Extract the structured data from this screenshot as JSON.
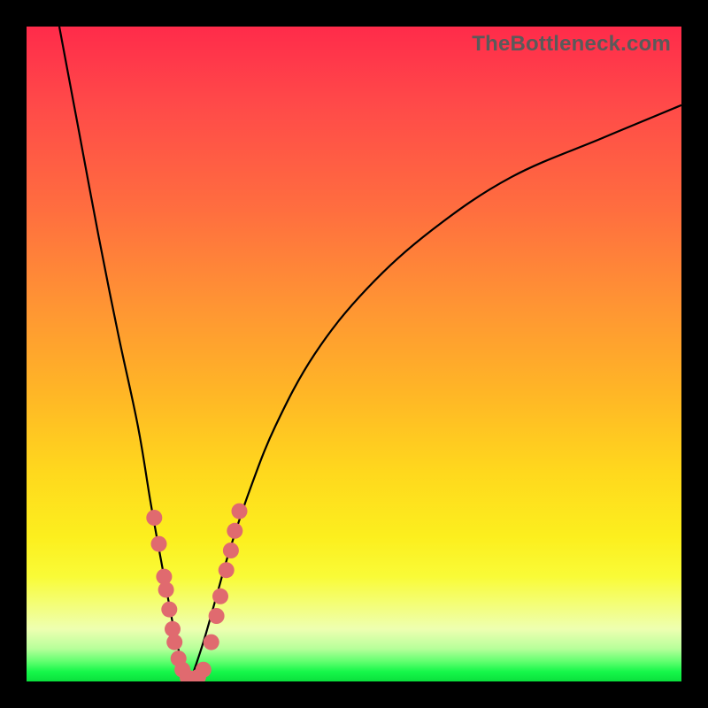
{
  "watermark": "TheBottleneck.com",
  "colors": {
    "frame": "#000000",
    "gradient_top": "#ff2b4a",
    "gradient_mid": "#ffd81d",
    "gradient_bottom": "#0ae03c",
    "curve": "#000000",
    "dots": "#e06a6f"
  },
  "chart_data": {
    "type": "line",
    "title": "",
    "xlabel": "",
    "ylabel": "",
    "xlim": [
      0,
      100
    ],
    "ylim": [
      0,
      100
    ],
    "note": "Two-branch V-shaped bottleneck curve. Values are bottleneck % (y, 0=bottom/no bottleneck, 100=top/severe) vs an implicit component-ratio axis (x). Points estimated from pixel positions.",
    "series": [
      {
        "name": "left-branch",
        "x": [
          5,
          8,
          11,
          14,
          17,
          19,
          21,
          22.5,
          23.7,
          25
        ],
        "y": [
          100,
          84,
          68,
          53,
          39,
          27,
          16,
          8,
          3,
          0
        ]
      },
      {
        "name": "right-branch",
        "x": [
          25,
          27,
          29,
          31,
          34,
          38,
          44,
          52,
          62,
          74,
          88,
          100
        ],
        "y": [
          0,
          6,
          13,
          20,
          29,
          39,
          50,
          60,
          69,
          77,
          83,
          88
        ]
      }
    ],
    "highlight_points": {
      "name": "cluster-near-minimum",
      "note": "Salmon dots clustered along both branches near the bottom of the V",
      "points": [
        {
          "x": 19.5,
          "y": 25
        },
        {
          "x": 20.2,
          "y": 21
        },
        {
          "x": 21.0,
          "y": 16
        },
        {
          "x": 21.3,
          "y": 14
        },
        {
          "x": 21.8,
          "y": 11
        },
        {
          "x": 22.3,
          "y": 8
        },
        {
          "x": 22.6,
          "y": 6
        },
        {
          "x": 23.2,
          "y": 3.5
        },
        {
          "x": 23.8,
          "y": 1.8
        },
        {
          "x": 24.6,
          "y": 0.6
        },
        {
          "x": 25.4,
          "y": 0.4
        },
        {
          "x": 26.2,
          "y": 0.7
        },
        {
          "x": 27.0,
          "y": 1.8
        },
        {
          "x": 28.2,
          "y": 6
        },
        {
          "x": 29.0,
          "y": 10
        },
        {
          "x": 29.6,
          "y": 13
        },
        {
          "x": 30.5,
          "y": 17
        },
        {
          "x": 31.2,
          "y": 20
        },
        {
          "x": 31.8,
          "y": 23
        },
        {
          "x": 32.5,
          "y": 26
        }
      ]
    }
  }
}
